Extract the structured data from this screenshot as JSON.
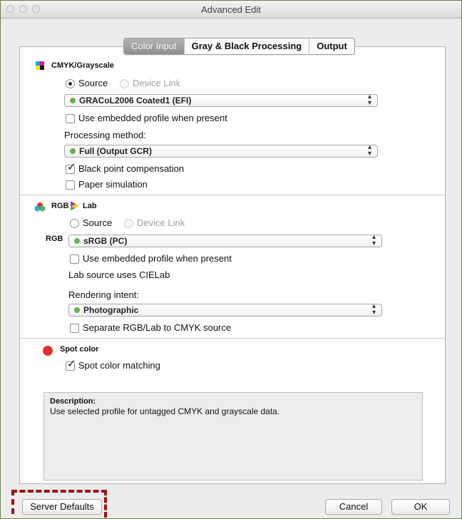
{
  "window": {
    "title": "Advanced Edit"
  },
  "tabs": [
    {
      "label": "Color Input",
      "active": true
    },
    {
      "label": "Gray & Black Processing",
      "active": false
    },
    {
      "label": "Output",
      "active": false
    }
  ],
  "cmyk": {
    "header": "CMYK/Grayscale",
    "source_label": "Source",
    "device_link_label": "Device Link",
    "source_selected": true,
    "profile": "GRACoL2006 Coated1 (EFI)",
    "embedded_label": "Use embedded profile when present",
    "embedded_checked": false,
    "processing_label": "Processing method:",
    "processing_value": "Full (Output GCR)",
    "bpc_label": "Black point compensation",
    "bpc_checked": true,
    "paper_label": "Paper simulation",
    "paper_checked": false
  },
  "rgb": {
    "header_rgb": "RGB",
    "header_lab": "Lab",
    "source_label": "Source",
    "device_link_label": "Device Link",
    "row_label": "RGB",
    "profile": "sRGB (PC)",
    "embedded_label": "Use embedded profile when present",
    "embedded_checked": false,
    "lab_note": "Lab source uses CIELab",
    "intent_label": "Rendering intent:",
    "intent_value": "Photographic",
    "separate_label": "Separate RGB/Lab to CMYK source",
    "separate_checked": false
  },
  "spot": {
    "header": "Spot color",
    "matching_label": "Spot color matching",
    "matching_checked": true
  },
  "description": {
    "title": "Description:",
    "text": "Use selected profile for untagged CMYK and grayscale data."
  },
  "buttons": {
    "server_defaults": "Server Defaults",
    "cancel": "Cancel",
    "ok": "OK"
  },
  "colors": {
    "window_border": "#6a7f4a",
    "highlight_dashed": "#9b1111",
    "status_dot": "#6ab04c",
    "spot_dot": "#e03030"
  }
}
